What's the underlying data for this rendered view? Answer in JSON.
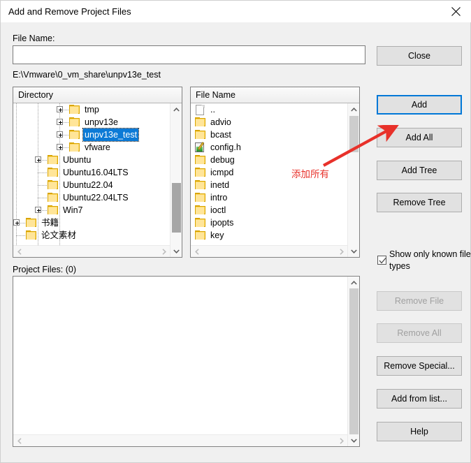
{
  "window": {
    "title": "Add and Remove Project Files",
    "close_icon": "close-icon"
  },
  "form": {
    "file_name_label": "File Name:",
    "file_name_value": "",
    "file_name_placeholder": "",
    "current_path": "E:\\Vmware\\0_vm_share\\unpv13e_test",
    "project_files_label": "Project Files: (0)"
  },
  "directory_panel": {
    "header": "Directory",
    "items": [
      {
        "label": "tmp",
        "depth": 3,
        "expandable": true,
        "selected": false,
        "icon": "folder-icon"
      },
      {
        "label": "unpv13e",
        "depth": 3,
        "expandable": true,
        "selected": false,
        "icon": "folder-icon"
      },
      {
        "label": "unpv13e_test",
        "depth": 3,
        "expandable": true,
        "selected": true,
        "icon": "folder-icon"
      },
      {
        "label": "vfware",
        "depth": 3,
        "expandable": true,
        "selected": false,
        "icon": "folder-icon"
      },
      {
        "label": "Ubuntu",
        "depth": 2,
        "expandable": true,
        "selected": false,
        "icon": "folder-icon"
      },
      {
        "label": "Ubuntu16.04LTS",
        "depth": 2,
        "expandable": false,
        "selected": false,
        "icon": "folder-icon"
      },
      {
        "label": "Ubuntu22.04",
        "depth": 2,
        "expandable": false,
        "selected": false,
        "icon": "folder-icon"
      },
      {
        "label": "Ubuntu22.04LTS",
        "depth": 2,
        "expandable": false,
        "selected": false,
        "icon": "folder-icon"
      },
      {
        "label": "Win7",
        "depth": 2,
        "expandable": true,
        "selected": false,
        "icon": "folder-icon"
      },
      {
        "label": "书籍",
        "depth": 1,
        "expandable": true,
        "selected": false,
        "icon": "folder-icon"
      },
      {
        "label": "论文素材",
        "depth": 1,
        "expandable": false,
        "selected": false,
        "icon": "folder-icon"
      }
    ]
  },
  "file_panel": {
    "header": "File Name",
    "items": [
      {
        "label": "..",
        "icon": "document-icon"
      },
      {
        "label": "advio",
        "icon": "folder-icon"
      },
      {
        "label": "bcast",
        "icon": "folder-icon"
      },
      {
        "label": "config.h",
        "icon": "source-file-icon"
      },
      {
        "label": "debug",
        "icon": "folder-icon"
      },
      {
        "label": "icmpd",
        "icon": "folder-icon"
      },
      {
        "label": "inetd",
        "icon": "folder-icon"
      },
      {
        "label": "intro",
        "icon": "folder-icon"
      },
      {
        "label": "ioctl",
        "icon": "folder-icon"
      },
      {
        "label": "ipopts",
        "icon": "folder-icon"
      },
      {
        "label": "key",
        "icon": "folder-icon"
      }
    ]
  },
  "project_files_panel": {
    "items": []
  },
  "buttons": {
    "close": "Close",
    "add": "Add",
    "add_all": "Add All",
    "add_tree": "Add Tree",
    "remove_tree": "Remove Tree",
    "remove_file": "Remove File",
    "remove_all": "Remove All",
    "remove_special": "Remove Special...",
    "add_from_list": "Add from list...",
    "help": "Help"
  },
  "checkbox": {
    "label": "Show only known file types",
    "checked": true
  },
  "annotation": {
    "text": "添加所有",
    "color": "#e8312a",
    "points_to": "add-all-button"
  },
  "colors": {
    "dialog_background": "#f0f0f0",
    "titlebar_background": "#ffffff",
    "selection_blue": "#0c7ad6",
    "focus_blue": "#0078d7",
    "folder_yellow": "#ffd966",
    "annotation_red": "#e8312a",
    "button_face": "#e1e1e1"
  }
}
